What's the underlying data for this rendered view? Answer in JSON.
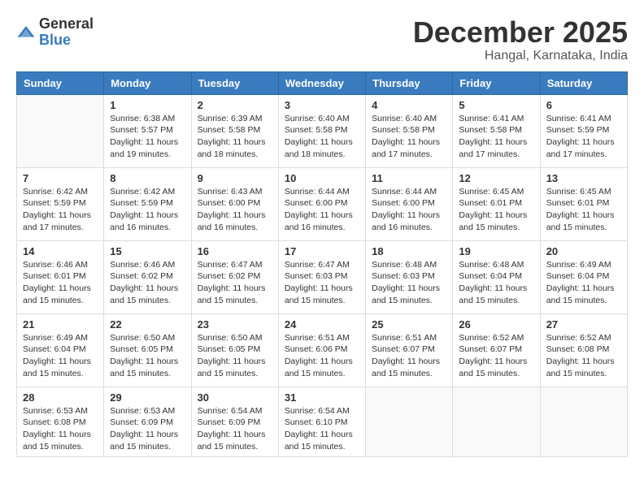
{
  "header": {
    "logo_general": "General",
    "logo_blue": "Blue",
    "month": "December 2025",
    "location": "Hangal, Karnataka, India"
  },
  "days_of_week": [
    "Sunday",
    "Monday",
    "Tuesday",
    "Wednesday",
    "Thursday",
    "Friday",
    "Saturday"
  ],
  "weeks": [
    [
      {
        "day": "",
        "info": ""
      },
      {
        "day": "1",
        "info": "Sunrise: 6:38 AM\nSunset: 5:57 PM\nDaylight: 11 hours and 19 minutes."
      },
      {
        "day": "2",
        "info": "Sunrise: 6:39 AM\nSunset: 5:58 PM\nDaylight: 11 hours and 18 minutes."
      },
      {
        "day": "3",
        "info": "Sunrise: 6:40 AM\nSunset: 5:58 PM\nDaylight: 11 hours and 18 minutes."
      },
      {
        "day": "4",
        "info": "Sunrise: 6:40 AM\nSunset: 5:58 PM\nDaylight: 11 hours and 17 minutes."
      },
      {
        "day": "5",
        "info": "Sunrise: 6:41 AM\nSunset: 5:58 PM\nDaylight: 11 hours and 17 minutes."
      },
      {
        "day": "6",
        "info": "Sunrise: 6:41 AM\nSunset: 5:59 PM\nDaylight: 11 hours and 17 minutes."
      }
    ],
    [
      {
        "day": "7",
        "info": "Sunrise: 6:42 AM\nSunset: 5:59 PM\nDaylight: 11 hours and 17 minutes."
      },
      {
        "day": "8",
        "info": "Sunrise: 6:42 AM\nSunset: 5:59 PM\nDaylight: 11 hours and 16 minutes."
      },
      {
        "day": "9",
        "info": "Sunrise: 6:43 AM\nSunset: 6:00 PM\nDaylight: 11 hours and 16 minutes."
      },
      {
        "day": "10",
        "info": "Sunrise: 6:44 AM\nSunset: 6:00 PM\nDaylight: 11 hours and 16 minutes."
      },
      {
        "day": "11",
        "info": "Sunrise: 6:44 AM\nSunset: 6:00 PM\nDaylight: 11 hours and 16 minutes."
      },
      {
        "day": "12",
        "info": "Sunrise: 6:45 AM\nSunset: 6:01 PM\nDaylight: 11 hours and 15 minutes."
      },
      {
        "day": "13",
        "info": "Sunrise: 6:45 AM\nSunset: 6:01 PM\nDaylight: 11 hours and 15 minutes."
      }
    ],
    [
      {
        "day": "14",
        "info": "Sunrise: 6:46 AM\nSunset: 6:01 PM\nDaylight: 11 hours and 15 minutes."
      },
      {
        "day": "15",
        "info": "Sunrise: 6:46 AM\nSunset: 6:02 PM\nDaylight: 11 hours and 15 minutes."
      },
      {
        "day": "16",
        "info": "Sunrise: 6:47 AM\nSunset: 6:02 PM\nDaylight: 11 hours and 15 minutes."
      },
      {
        "day": "17",
        "info": "Sunrise: 6:47 AM\nSunset: 6:03 PM\nDaylight: 11 hours and 15 minutes."
      },
      {
        "day": "18",
        "info": "Sunrise: 6:48 AM\nSunset: 6:03 PM\nDaylight: 11 hours and 15 minutes."
      },
      {
        "day": "19",
        "info": "Sunrise: 6:48 AM\nSunset: 6:04 PM\nDaylight: 11 hours and 15 minutes."
      },
      {
        "day": "20",
        "info": "Sunrise: 6:49 AM\nSunset: 6:04 PM\nDaylight: 11 hours and 15 minutes."
      }
    ],
    [
      {
        "day": "21",
        "info": "Sunrise: 6:49 AM\nSunset: 6:04 PM\nDaylight: 11 hours and 15 minutes."
      },
      {
        "day": "22",
        "info": "Sunrise: 6:50 AM\nSunset: 6:05 PM\nDaylight: 11 hours and 15 minutes."
      },
      {
        "day": "23",
        "info": "Sunrise: 6:50 AM\nSunset: 6:05 PM\nDaylight: 11 hours and 15 minutes."
      },
      {
        "day": "24",
        "info": "Sunrise: 6:51 AM\nSunset: 6:06 PM\nDaylight: 11 hours and 15 minutes."
      },
      {
        "day": "25",
        "info": "Sunrise: 6:51 AM\nSunset: 6:07 PM\nDaylight: 11 hours and 15 minutes."
      },
      {
        "day": "26",
        "info": "Sunrise: 6:52 AM\nSunset: 6:07 PM\nDaylight: 11 hours and 15 minutes."
      },
      {
        "day": "27",
        "info": "Sunrise: 6:52 AM\nSunset: 6:08 PM\nDaylight: 11 hours and 15 minutes."
      }
    ],
    [
      {
        "day": "28",
        "info": "Sunrise: 6:53 AM\nSunset: 6:08 PM\nDaylight: 11 hours and 15 minutes."
      },
      {
        "day": "29",
        "info": "Sunrise: 6:53 AM\nSunset: 6:09 PM\nDaylight: 11 hours and 15 minutes."
      },
      {
        "day": "30",
        "info": "Sunrise: 6:54 AM\nSunset: 6:09 PM\nDaylight: 11 hours and 15 minutes."
      },
      {
        "day": "31",
        "info": "Sunrise: 6:54 AM\nSunset: 6:10 PM\nDaylight: 11 hours and 15 minutes."
      },
      {
        "day": "",
        "info": ""
      },
      {
        "day": "",
        "info": ""
      },
      {
        "day": "",
        "info": ""
      }
    ]
  ]
}
